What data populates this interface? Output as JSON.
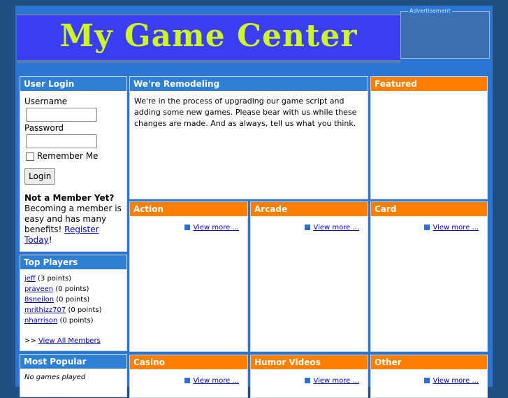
{
  "header": {
    "title": "My Game Center",
    "ad_label": "Advertisement"
  },
  "login": {
    "title": "User Login",
    "username_label": "Username",
    "password_label": "Password",
    "remember_label": "Remember Me",
    "button": "Login",
    "not_member_title": "Not a Member Yet?",
    "not_member_text": "Becoming a member is easy and has many benefits!",
    "register_link": "Register Today",
    "register_suffix": "!"
  },
  "top_players": {
    "title": "Top Players",
    "players": [
      {
        "name": "jeff",
        "points": "(3 points)"
      },
      {
        "name": "praveen",
        "points": "(0 points)"
      },
      {
        "name": "8sneilon",
        "points": "(0 points)"
      },
      {
        "name": "mrithizz707",
        "points": "(0 points)"
      },
      {
        "name": "nharrison",
        "points": "(0 points)"
      }
    ],
    "view_all_prefix": ">> ",
    "view_all": "View All Members"
  },
  "most_popular": {
    "title": "Most Popular",
    "empty": "No games played"
  },
  "remodel": {
    "title": "We're Remodeling",
    "text": "We're in the process of upgrading our game script and adding some new games. Please bear with us while these changes are made. And as always, tell us what you think."
  },
  "featured": {
    "title": "Featured"
  },
  "view_more": "View more ...",
  "categories": [
    "Action",
    "Arcade",
    "Card",
    "Casino",
    "Humor Videos",
    "Other"
  ]
}
